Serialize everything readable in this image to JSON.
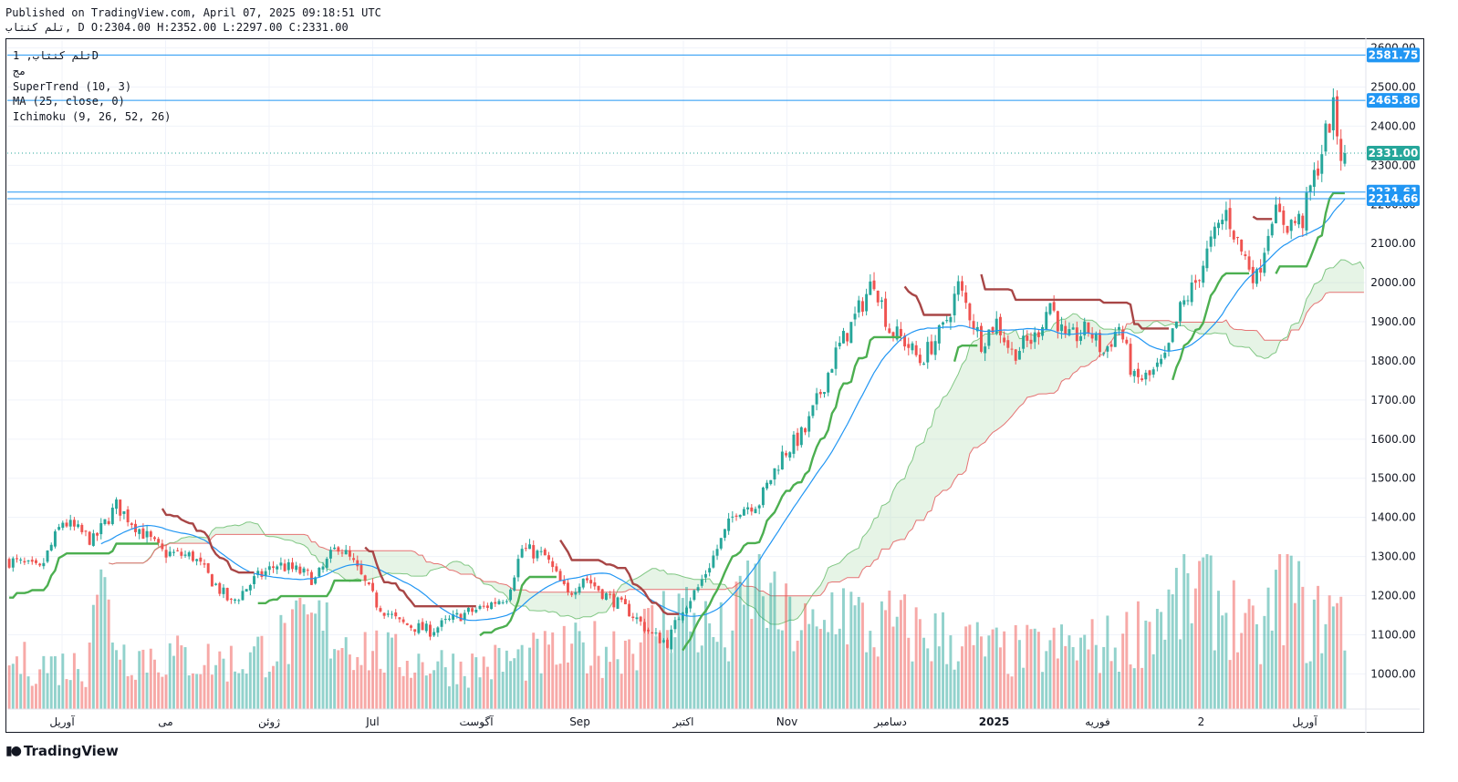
{
  "header": {
    "published": "Published on TradingView.com, April 07, 2025 09:18:51 UTC",
    "ohlc": "تلم کنتاب, D O:2304.00 H:2352.00 L:2297.00 C:2331.00"
  },
  "legend": {
    "symbol": "تلم کنتاب, 1D",
    "symbol_sub": "مج",
    "indicators": [
      "SuperTrend (10, 3)",
      "MA (25, close, 0)",
      "Ichimoku (9, 26, 52, 26)"
    ]
  },
  "branding": {
    "name": "TradingView",
    "logo_icon": "tradingview-logo-icon"
  },
  "colors": {
    "up": "#26a69a",
    "down": "#ef5350",
    "supertrend_up": "#4caf50",
    "supertrend_down": "#a84646",
    "ma": "#2196f3",
    "hline": "#2196f3",
    "cloud_bull": "#a5d6a7",
    "cloud_bear": "#f8bbd0"
  },
  "chart_data": {
    "type": "candlestick",
    "y_axis": {
      "position": "right",
      "ylim": [
        910,
        2620
      ],
      "ticks": [
        "2600.00",
        "2500.00",
        "2400.00",
        "2300.00",
        "2200.00",
        "2100.00",
        "2000.00",
        "1900.00",
        "1800.00",
        "1700.00",
        "1600.00",
        "1500.00",
        "1400.00",
        "1300.00",
        "1200.00",
        "1100.00",
        "1000.00"
      ]
    },
    "x_axis": {
      "labels": [
        "آوریل",
        "می",
        "ژوئن",
        "Jul",
        "آگوست",
        "Sep",
        "اکتبر",
        "Nov",
        "دسامبر",
        "2025",
        "فوریه",
        "2",
        "آوریل"
      ]
    },
    "price_lines": [
      {
        "value": 2581.75,
        "label": "2581.75",
        "style": "solid"
      },
      {
        "value": 2465.86,
        "label": "2465.86",
        "style": "solid"
      },
      {
        "value": 2331.0,
        "label": "2331.00",
        "style": "dotted",
        "color": "#26a69a"
      },
      {
        "value": 2231.61,
        "label": "2231.61",
        "style": "solid"
      },
      {
        "value": 2214.66,
        "label": "2214.66",
        "style": "solid"
      }
    ],
    "ohlc_anchors": [
      [
        0,
        1290
      ],
      [
        8,
        1265
      ],
      [
        14,
        1390
      ],
      [
        22,
        1340
      ],
      [
        28,
        1430
      ],
      [
        34,
        1370
      ],
      [
        40,
        1310
      ],
      [
        48,
        1300
      ],
      [
        52,
        1250
      ],
      [
        58,
        1180
      ],
      [
        64,
        1240
      ],
      [
        70,
        1280
      ],
      [
        76,
        1260
      ],
      [
        80,
        1240
      ],
      [
        86,
        1330
      ],
      [
        90,
        1280
      ],
      [
        96,
        1180
      ],
      [
        102,
        1130
      ],
      [
        110,
        1110
      ],
      [
        118,
        1150
      ],
      [
        124,
        1170
      ],
      [
        130,
        1200
      ],
      [
        134,
        1320
      ],
      [
        140,
        1300
      ],
      [
        146,
        1200
      ],
      [
        150,
        1250
      ],
      [
        156,
        1200
      ],
      [
        162,
        1160
      ],
      [
        168,
        1100
      ],
      [
        172,
        1080
      ],
      [
        176,
        1170
      ],
      [
        180,
        1220
      ],
      [
        184,
        1300
      ],
      [
        190,
        1420
      ],
      [
        196,
        1440
      ],
      [
        202,
        1560
      ],
      [
        208,
        1620
      ],
      [
        212,
        1720
      ],
      [
        216,
        1820
      ],
      [
        220,
        1890
      ],
      [
        226,
        2010
      ],
      [
        230,
        1880
      ],
      [
        234,
        1850
      ],
      [
        238,
        1800
      ],
      [
        244,
        1880
      ],
      [
        248,
        1990
      ],
      [
        254,
        1850
      ],
      [
        258,
        1900
      ],
      [
        262,
        1820
      ],
      [
        268,
        1860
      ],
      [
        272,
        1950
      ],
      [
        276,
        1850
      ],
      [
        282,
        1880
      ],
      [
        286,
        1820
      ],
      [
        290,
        1890
      ],
      [
        294,
        1750
      ],
      [
        298,
        1760
      ],
      [
        302,
        1800
      ],
      [
        306,
        1930
      ],
      [
        310,
        2000
      ],
      [
        314,
        2100
      ],
      [
        318,
        2180
      ],
      [
        322,
        2080
      ],
      [
        326,
        2010
      ],
      [
        330,
        2180
      ],
      [
        334,
        2150
      ],
      [
        338,
        2160
      ],
      [
        340,
        2240
      ],
      [
        342,
        2300
      ],
      [
        344,
        2380
      ],
      [
        346,
        2440
      ],
      [
        348,
        2331
      ]
    ],
    "volume_anchors": [
      [
        0,
        1000
      ],
      [
        20,
        900
      ],
      [
        22,
        3000
      ],
      [
        30,
        1200
      ],
      [
        60,
        1000
      ],
      [
        80,
        1800
      ],
      [
        100,
        1100
      ],
      [
        120,
        900
      ],
      [
        160,
        1400
      ],
      [
        168,
        1700
      ],
      [
        175,
        2200
      ],
      [
        180,
        1800
      ],
      [
        188,
        1500
      ],
      [
        196,
        3000
      ],
      [
        200,
        2000
      ],
      [
        206,
        1800
      ],
      [
        212,
        1500
      ],
      [
        216,
        2400
      ],
      [
        225,
        1600
      ],
      [
        230,
        1800
      ],
      [
        260,
        1200
      ],
      [
        290,
        1400
      ],
      [
        300,
        2000
      ],
      [
        312,
        2600
      ],
      [
        320,
        2000
      ],
      [
        326,
        1400
      ],
      [
        334,
        2800
      ],
      [
        340,
        1600
      ],
      [
        344,
        2200
      ],
      [
        348,
        1900
      ]
    ]
  }
}
